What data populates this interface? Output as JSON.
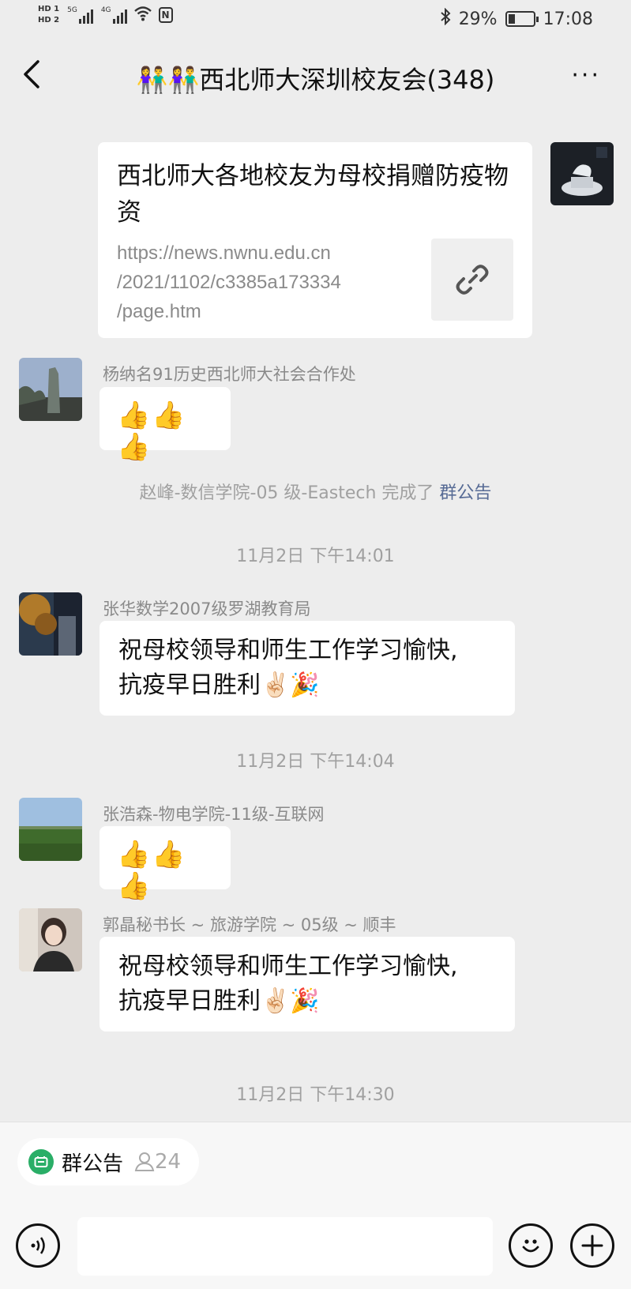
{
  "status_bar": {
    "hd1": "HD 1",
    "hd2": "HD 2",
    "sig1_label": "5G",
    "sig2_label": "4G",
    "nfc_label": "N",
    "battery_percent": "29%",
    "battery_level": 0.29,
    "time": "17:08"
  },
  "header": {
    "emoji": "👫👫",
    "title": "西北师大深圳校友会(348)",
    "more": "···"
  },
  "link_card": {
    "title": "西北师大各地校友为母校捐赠防疫物资",
    "url_lines": [
      "https://news.nwnu.edu.cn",
      "/2021/1102/c3385a173334",
      "/page.htm"
    ]
  },
  "messages": [
    {
      "name": "杨纳名91历史西北师大社会合作处",
      "text": "👍👍👍"
    },
    {
      "name": "张华数学2007级罗湖教育局",
      "text_line1": "祝母校领导和师生工作学习愉快,",
      "text_line2": "抗疫早日胜利✌🏻🎉"
    },
    {
      "name": "张浩森-物电学院-11级-互联网",
      "text": "👍👍👍"
    },
    {
      "name": "郭晶秘书长 ~ 旅游学院 ~ 05级 ~ 顺丰",
      "text_line1": "祝母校领导和师生工作学习愉快,",
      "text_line2": "抗疫早日胜利✌🏻🎉"
    }
  ],
  "system_notice": {
    "prefix": "赵峰-数信学院-05 级-Eastech 完成了 ",
    "link": "群公告"
  },
  "timestamps": [
    "11月2日 下午14:01",
    "11月2日 下午14:04",
    "11月2日 下午14:30"
  ],
  "bottom": {
    "notice_label": "群公告",
    "notice_count": "24",
    "colors": {
      "accent_green": "#2aae67",
      "link_blue": "#576b95"
    }
  },
  "icons": [
    "back-arrow-icon",
    "more-icon",
    "link-icon",
    "notice-icon",
    "person-icon",
    "voice-icon",
    "emoji-icon",
    "plus-icon"
  ]
}
